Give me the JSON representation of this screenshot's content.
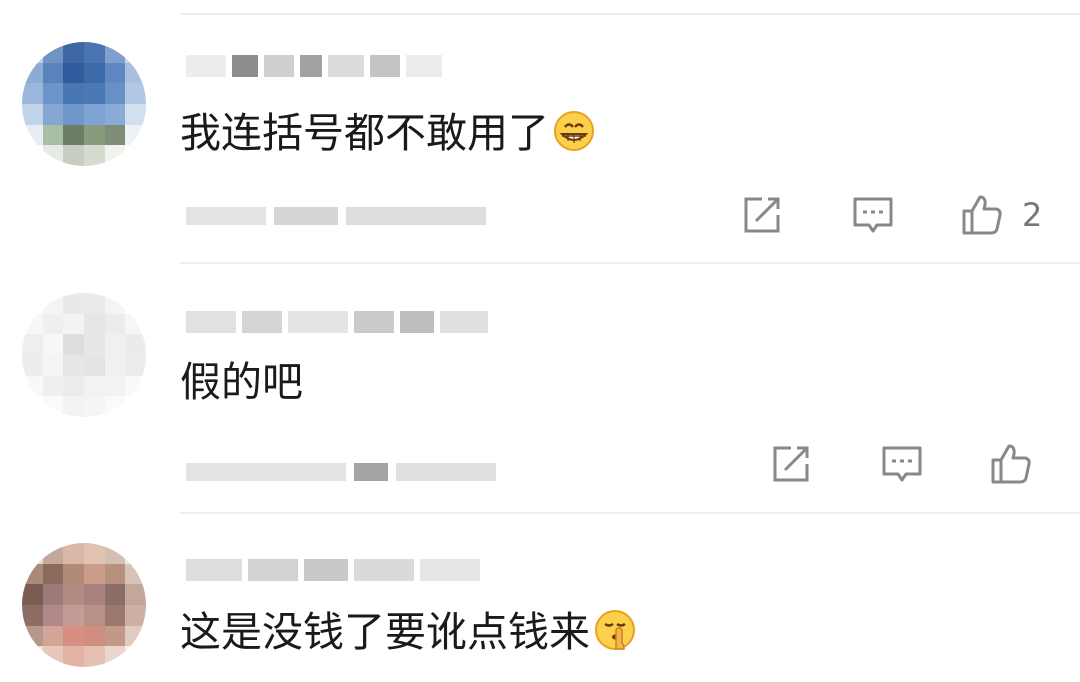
{
  "comments": [
    {
      "text": "我连括号都不敢用了",
      "emoji": "grinning-face-icon",
      "like_count": "2"
    },
    {
      "text": "假的吧",
      "emoji": "",
      "like_count": ""
    },
    {
      "text": "这是没钱了要讹点钱来",
      "emoji": "shushing-face-icon",
      "like_count": ""
    }
  ],
  "colors": {
    "icon": "#888888",
    "text": "#1a1a1a",
    "divider": "#eeeeee"
  }
}
